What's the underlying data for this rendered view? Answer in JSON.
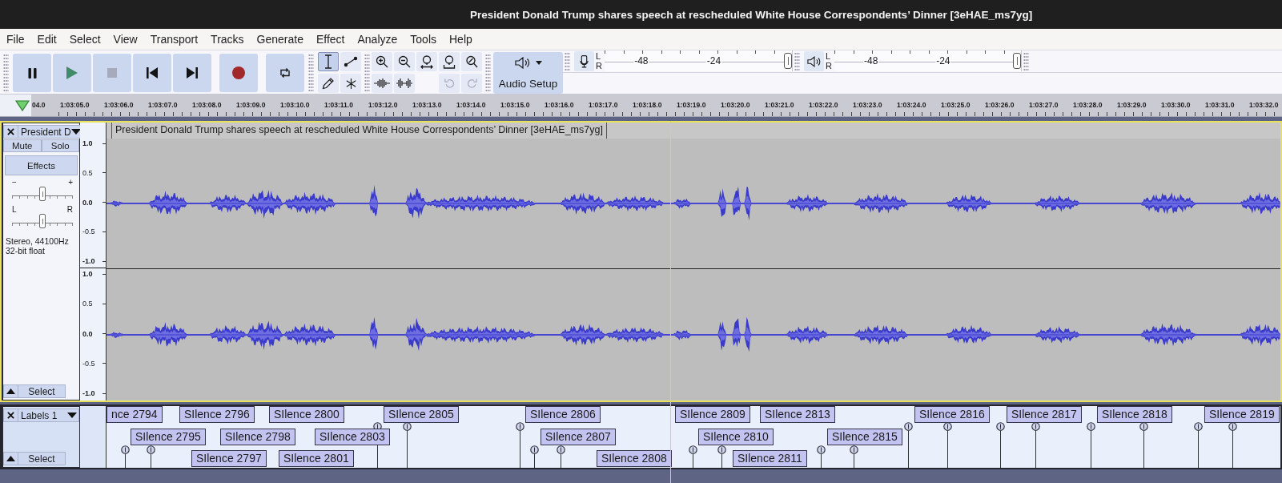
{
  "window": {
    "title": "President Donald Trump shares speech at rescheduled White House Correspondents’ Dinner [3eHAE_ms7yg]"
  },
  "menu": [
    "File",
    "Edit",
    "Select",
    "View",
    "Transport",
    "Tracks",
    "Generate",
    "Effect",
    "Analyze",
    "Tools",
    "Help"
  ],
  "toolbar": {
    "transport": [
      {
        "kind": "pause",
        "disabled": false
      },
      {
        "kind": "play",
        "disabled": false
      },
      {
        "kind": "stop",
        "disabled": true
      },
      {
        "kind": "skip_start",
        "disabled": false
      },
      {
        "kind": "skip_end",
        "disabled": false
      },
      {
        "kind": "record",
        "disabled": false
      },
      {
        "kind": "loop",
        "disabled": false
      }
    ],
    "tools": [
      {
        "kind": "select",
        "selected": true
      },
      {
        "kind": "envelope",
        "selected": false
      },
      {
        "kind": "draw",
        "selected": false
      },
      {
        "kind": "multi",
        "selected": false
      }
    ],
    "edit": [
      {
        "kind": "zoom_in",
        "disabled": false
      },
      {
        "kind": "zoom_out",
        "disabled": false
      },
      {
        "kind": "fit_selection",
        "disabled": false
      },
      {
        "kind": "fit_project",
        "disabled": false
      },
      {
        "kind": "zoom_toggle",
        "disabled": false
      },
      {
        "kind": "trim",
        "disabled": false
      },
      {
        "kind": "silence",
        "disabled": false
      },
      {
        "kind": "undo",
        "disabled": true
      },
      {
        "kind": "redo",
        "disabled": true
      }
    ],
    "audio_setup": {
      "label": "Audio Setup"
    },
    "meters": [
      {
        "kind": "record",
        "channels": [
          "L",
          "R"
        ],
        "scale": [
          "-48",
          "-24"
        ],
        "level": 1
      },
      {
        "kind": "playback",
        "channels": [
          "L",
          "R"
        ],
        "scale": [
          "-48",
          "-24"
        ],
        "level": 1
      }
    ]
  },
  "timeline": {
    "labels": [
      "04.0",
      "1:03:05.0",
      "1:03:06.0",
      "1:03:07.0",
      "1:03:08.0",
      "1:03:09.0",
      "1:03:10.0",
      "1:03:11.0",
      "1:03:12.0",
      "1:03:13.0",
      "1:03:14.0",
      "1:03:15.0",
      "1:03:16.0",
      "1:03:17.0",
      "1:03:18.0",
      "1:03:19.0",
      "1:03:20.0",
      "1:03:21.0",
      "1:03:22.0",
      "1:03:23.0",
      "1:03:24.0",
      "1:03:25.0",
      "1:03:26.0",
      "1:03:27.0",
      "1:03:28.0",
      "1:03:29.0",
      "1:03:30.0",
      "1:03:31.0",
      "1:03:32.0"
    ]
  },
  "audio_track": {
    "name": "President D",
    "focused": true,
    "mute": "Mute",
    "solo": "Solo",
    "effects": "Effects",
    "gain": {
      "minus": "−",
      "plus": "+",
      "level": 0.5
    },
    "pan": {
      "left": "L",
      "right": "R",
      "level": 0.5
    },
    "info": [
      "Stereo, 44100Hz",
      "32-bit float"
    ],
    "select": "Select",
    "clip_title": "President Donald Trump shares speech at rescheduled White House Correspondents’ Dinner [3eHAE_ms7yg]",
    "channels": [
      {
        "scale": [
          "1.0",
          "0.5",
          "0.0",
          "-0.5",
          "-1.0"
        ]
      },
      {
        "scale": [
          "1.0",
          "0.5",
          "0.0",
          "-0.5",
          "-1.0"
        ]
      }
    ]
  },
  "label_track": {
    "name": "Labels 1",
    "focused": false,
    "select": "Select",
    "labels": [
      {
        "text": "nce 2794"
      },
      {
        "text": "SIlence 2796"
      },
      {
        "text": "SIlence 2800"
      },
      {
        "text": "SIlence 2805"
      },
      {
        "text": "SIlence 2806"
      },
      {
        "text": "SIlence 2809"
      },
      {
        "text": "SIlence 2813"
      },
      {
        "text": "SIlence 2816"
      },
      {
        "text": "SIlence 2817"
      },
      {
        "text": "SIlence 2818"
      },
      {
        "text": "SIlence 2819"
      },
      {
        "text": "SIlence 2795"
      },
      {
        "text": "SIlence 2798"
      },
      {
        "text": "SIlence 2803"
      },
      {
        "text": "SIlence 2807"
      },
      {
        "text": "SIlence 2810"
      },
      {
        "text": "SIlence 2815"
      },
      {
        "text": "SIlence 2797"
      },
      {
        "text": "SIlence 2801"
      },
      {
        "text": "SIlence 2808"
      },
      {
        "text": "SIlence 2811"
      }
    ]
  }
}
